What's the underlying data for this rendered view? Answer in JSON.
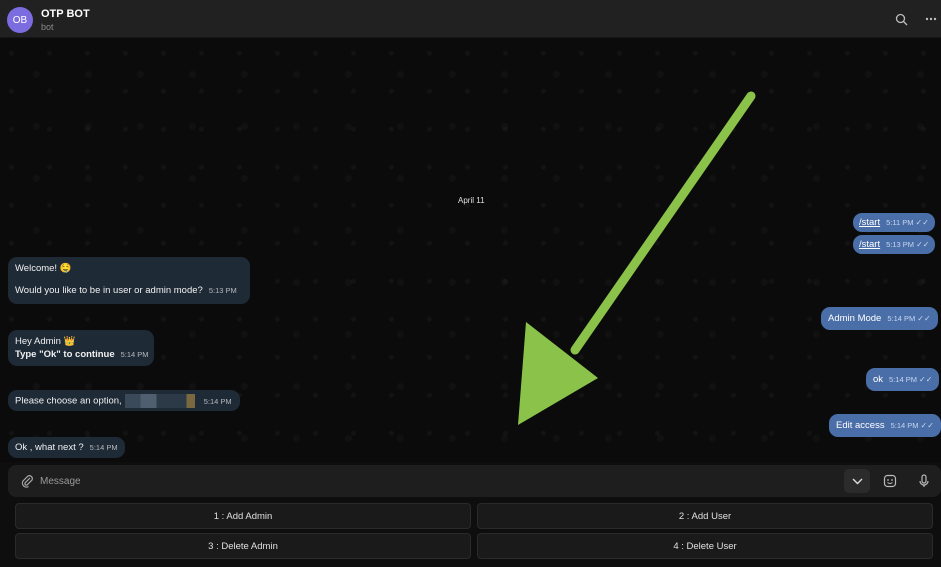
{
  "header": {
    "avatar_initials": "OB",
    "title": "OTP BOT",
    "subtitle": "bot",
    "search_icon": "search-icon",
    "menu_icon": "more-icon"
  },
  "chat": {
    "date_separator": "April 11",
    "outgoing": [
      {
        "text": "/start",
        "time": "5:11 PM",
        "is_link": true
      },
      {
        "text": "/start",
        "time": "5:13 PM",
        "is_link": true
      },
      {
        "text": "Admin Mode",
        "time": "5:14 PM"
      },
      {
        "text": "ok",
        "time": "5:14 PM"
      },
      {
        "text": "Edit access",
        "time": "5:14 PM"
      }
    ],
    "incoming": [
      {
        "line1": "Welcome! 🤤",
        "line2": "Would you like to be in user or admin mode?",
        "time": "5:13 PM"
      },
      {
        "line1": "Hey Admin 👑",
        "line2": "Type \"Ok\" to continue",
        "time": "5:14 PM"
      },
      {
        "text": "Please choose an option,",
        "time": "5:14 PM"
      },
      {
        "text": "Ok , what next ?",
        "time": "5:14 PM"
      }
    ]
  },
  "composer": {
    "placeholder": "Message",
    "attach_icon": "paperclip-icon",
    "keyboard_toggle_icon": "chevron-down-icon",
    "sticker_icon": "sticker-icon",
    "mic_icon": "microphone-icon"
  },
  "keyboard": {
    "buttons": [
      {
        "label": "1 : Add Admin"
      },
      {
        "label": "2 : Add User"
      },
      {
        "label": "3 : Delete Admin"
      },
      {
        "label": "4 : Delete User"
      }
    ]
  },
  "colors": {
    "outgoing_bubble": "#4a6ea8",
    "incoming_bubble": "#1f2a37",
    "arrow": "#8bc34a"
  }
}
